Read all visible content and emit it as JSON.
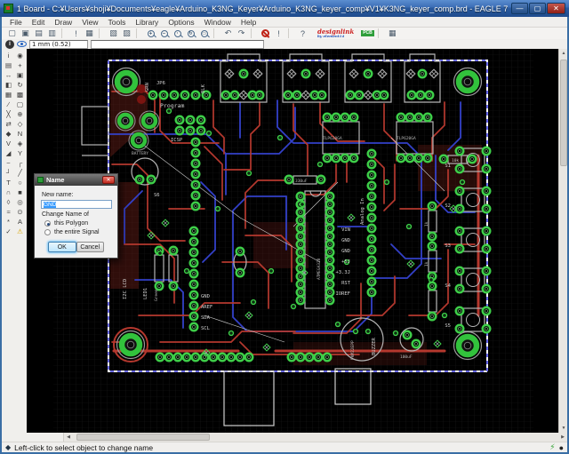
{
  "window": {
    "title": "1 Board - C:¥Users¥shoji¥Documents¥eagle¥Arduino_K3NG_Keyer¥Arduino_K3NG_keyer_comp¥V1¥K3NG_keyer_comp.brd - EAGLE 7.2.0 Light",
    "controls": {
      "minimize": "—",
      "maximize": "▢",
      "close": "✕"
    }
  },
  "menu": {
    "items": [
      "File",
      "Edit",
      "Draw",
      "View",
      "Tools",
      "Library",
      "Options",
      "Window",
      "Help"
    ]
  },
  "toolbar": {
    "buttons": [
      {
        "name": "open",
        "glyph": "▢"
      },
      {
        "name": "save",
        "glyph": "▣"
      },
      {
        "name": "print",
        "glyph": "▤"
      },
      {
        "name": "cam-processor",
        "glyph": "▥"
      },
      {
        "name": "run-script",
        "glyph": "!"
      },
      {
        "name": "use-library",
        "glyph": "▦"
      },
      {
        "name": "sheet-a",
        "glyph": "▧"
      },
      {
        "name": "sheet-b",
        "glyph": "▨"
      },
      {
        "name": "undo",
        "glyph": "↶"
      },
      {
        "name": "redo",
        "glyph": "↷"
      },
      {
        "name": "go",
        "glyph": "!"
      },
      {
        "name": "help",
        "glyph": "?"
      }
    ],
    "mags": [
      "+",
      "−",
      "·",
      "↻",
      "▭"
    ],
    "logo_designlink": "designlink",
    "logo_designlink_sub": "by element14",
    "logo_pcb": "PCB",
    "grid_button_glyph": "▦",
    "grid_field": "1 mm (0.52)",
    "command_field": ""
  },
  "palette": {
    "tools": [
      {
        "name": "info",
        "glyph": "i"
      },
      {
        "name": "show",
        "glyph": "◉"
      },
      {
        "name": "display",
        "glyph": "▤"
      },
      {
        "name": "mark",
        "glyph": "+"
      },
      {
        "name": "move",
        "glyph": "↔"
      },
      {
        "name": "copy",
        "glyph": "▣"
      },
      {
        "name": "mirror",
        "glyph": "◧"
      },
      {
        "name": "rotate",
        "glyph": "↻"
      },
      {
        "name": "group",
        "glyph": "▦"
      },
      {
        "name": "change",
        "glyph": "▩"
      },
      {
        "name": "cut",
        "glyph": "∕"
      },
      {
        "name": "paste",
        "glyph": "▢"
      },
      {
        "name": "delete",
        "glyph": "╳"
      },
      {
        "name": "add",
        "glyph": "⊕"
      },
      {
        "name": "pinswap",
        "glyph": "⇄"
      },
      {
        "name": "replace",
        "glyph": "◇"
      },
      {
        "name": "lock",
        "glyph": "◆"
      },
      {
        "name": "name",
        "glyph": "N"
      },
      {
        "name": "value",
        "glyph": "V"
      },
      {
        "name": "smash",
        "glyph": "◈"
      },
      {
        "name": "miter",
        "glyph": "◢"
      },
      {
        "name": "split",
        "glyph": "Y"
      },
      {
        "name": "optimize",
        "glyph": "~"
      },
      {
        "name": "route",
        "glyph": "┌"
      },
      {
        "name": "ripup",
        "glyph": "┘"
      },
      {
        "name": "wire",
        "glyph": "╱"
      },
      {
        "name": "text",
        "glyph": "T"
      },
      {
        "name": "circle",
        "glyph": "○"
      },
      {
        "name": "arc",
        "glyph": "∩"
      },
      {
        "name": "rect",
        "glyph": "■"
      },
      {
        "name": "polygon",
        "glyph": "◊"
      },
      {
        "name": "via",
        "glyph": "◎"
      },
      {
        "name": "signal",
        "glyph": "≈"
      },
      {
        "name": "hole",
        "glyph": "⊙"
      },
      {
        "name": "ratsnest",
        "glyph": "*"
      },
      {
        "name": "auto",
        "glyph": "A"
      },
      {
        "name": "drc",
        "glyph": "✓"
      },
      {
        "name": "errors",
        "glyph": "⚠"
      }
    ]
  },
  "dialog": {
    "title": "Name",
    "new_name_label": "New name:",
    "name_value": "GND",
    "change_label": "Change Name of",
    "radio_polygon": "this Polygon",
    "radio_signal": "the entire Signal",
    "ok": "OK",
    "cancel": "Cancel"
  },
  "statusbar": {
    "icon": "◆",
    "message": "Left-click to select object to change name"
  },
  "board": {
    "labels": [
      {
        "text": "JP6"
      },
      {
        "text": "GRN"
      },
      {
        "text": "BLK"
      },
      {
        "text": "Program"
      },
      {
        "text": "ICSP"
      },
      {
        "text": "S6"
      },
      {
        "text": "BATTERY"
      },
      {
        "text": "I2C LCD"
      },
      {
        "text": "LED1"
      },
      {
        "text": "Green"
      },
      {
        "text": "GND"
      },
      {
        "text": "AREF"
      },
      {
        "text": "SDA"
      },
      {
        "text": "SCL"
      },
      {
        "text": "Analog In"
      },
      {
        "text": "VIN"
      },
      {
        "text": "GND"
      },
      {
        "text": "GND"
      },
      {
        "text": "+5J"
      },
      {
        "text": "+3.3J"
      },
      {
        "text": "RST"
      },
      {
        "text": "IOREF"
      },
      {
        "text": "TLP620GA"
      },
      {
        "text": "TLP620GA"
      },
      {
        "text": "330uF"
      },
      {
        "text": "10k"
      },
      {
        "text": "1k"
      },
      {
        "text": "1k"
      },
      {
        "text": "S1"
      },
      {
        "text": "S2"
      },
      {
        "text": "S3"
      },
      {
        "text": "S4"
      },
      {
        "text": "S5"
      },
      {
        "text": "BUZZER"
      },
      {
        "text": "100uF"
      },
      {
        "text": "ATMEGA328"
      },
      {
        "text": "PKM22EPP"
      }
    ]
  }
}
